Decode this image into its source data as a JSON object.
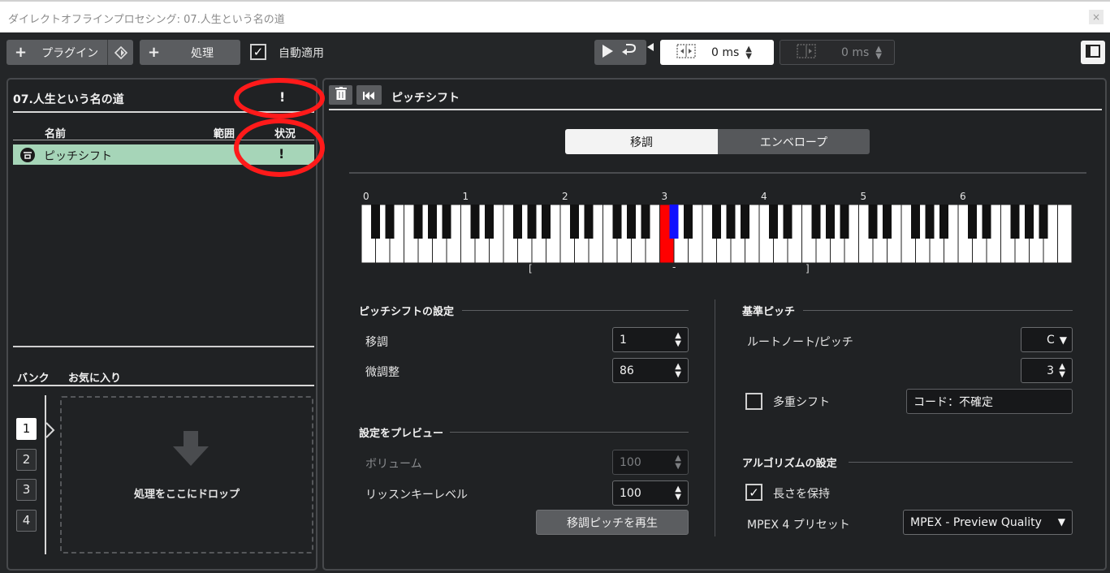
{
  "window": {
    "title": "ダイレクトオフラインプロセシング: 07.人生という名の道",
    "close": "×"
  },
  "toolbar": {
    "plugin_label": "プラグイン",
    "process_label": "処理",
    "auto_apply_label": "自動適用",
    "auto_apply_checked": "✓",
    "pre_roll_value": "0 ms",
    "post_roll_value": "0 ms"
  },
  "left_panel": {
    "track_title": "07.人生という名の道",
    "header_status": "!",
    "col_name": "名前",
    "col_range": "範囲",
    "col_status": "状況",
    "items": [
      {
        "name": "ピッチシフト",
        "status": "!"
      }
    ],
    "tab_bank": "バンク",
    "tab_favorites": "お気に入り",
    "banks": [
      "1",
      "2",
      "3",
      "4"
    ],
    "drop_text": "処理をここにドロップ"
  },
  "right_panel": {
    "title": "ピッチシフト",
    "tab_transpose": "移調",
    "tab_envelope": "エンベロープ",
    "octave_labels": [
      "0",
      "1",
      "2",
      "3",
      "4",
      "5",
      "6"
    ],
    "range_left": "[",
    "range_mid": "-",
    "range_right": "]",
    "pitch_settings_label": "ピッチシフトの設定",
    "transpose_label": "移調",
    "transpose_value": "1",
    "fine_tune_label": "微調整",
    "fine_tune_value": "86",
    "preview_settings_label": "設定をプレビュー",
    "volume_label": "ボリューム",
    "volume_value": "100",
    "listen_key_label": "リッスンキーレベル",
    "listen_key_value": "100",
    "play_transposed_label": "移調ピッチを再生",
    "base_pitch_label": "基準ピッチ",
    "root_note_label": "ルートノート/ピッチ",
    "root_note_value": "C",
    "root_octave_value": "3",
    "multi_shift_label": "多重シフト",
    "chord_value": "コード：不確定",
    "algorithm_label": "アルゴリズムの設定",
    "keep_length_label": "長さを保持",
    "keep_length_checked": "✓",
    "mpex_label": "MPEX 4 プリセット",
    "mpex_value": "MPEX - Preview Quality"
  },
  "colors": {
    "accent_green": "#a6d5b8",
    "red_key": "#ff0000",
    "blue_key": "#1010ff",
    "annotation_red": "#ff1a1a"
  }
}
